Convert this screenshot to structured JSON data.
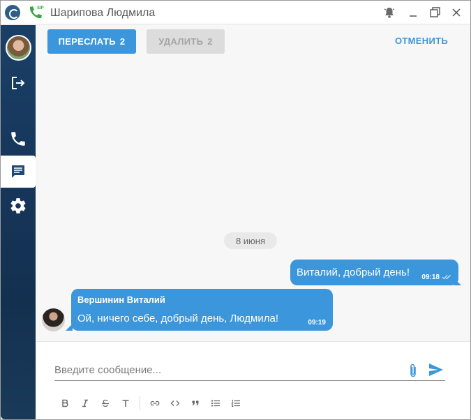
{
  "window": {
    "title": "Шарипова Людмила",
    "sip_badge": "SIP"
  },
  "toolbar": {
    "forward_label": "ПЕРЕСЛАТЬ",
    "forward_count": "2",
    "delete_label": "УДАЛИТЬ",
    "delete_count": "2",
    "cancel_label": "ОТМЕНИТЬ"
  },
  "chat": {
    "date": "8 июня",
    "messages": [
      {
        "direction": "out",
        "text": "Виталий, добрый день!",
        "time": "09:18",
        "status": "read"
      },
      {
        "direction": "in",
        "sender": "Вершинин Виталий",
        "text": "Ой, ничего себе, добрый день, Людмила!",
        "time": "09:19"
      }
    ]
  },
  "composer": {
    "placeholder": "Введите сообщение..."
  },
  "format_buttons": [
    "bold-icon",
    "italic-icon",
    "strikethrough-icon",
    "text-style-icon",
    "link-icon",
    "code-icon",
    "quote-icon",
    "bullet-list-icon",
    "numbered-list-icon"
  ],
  "sidebar_icons": [
    "avatar",
    "logout-icon",
    "phone-icon",
    "chat-icon",
    "gear-icon"
  ],
  "colors": {
    "accent": "#3b96db",
    "sidebar": "#16365a",
    "disabled": "#dcdcdc",
    "sip_green": "#3aa44a"
  }
}
